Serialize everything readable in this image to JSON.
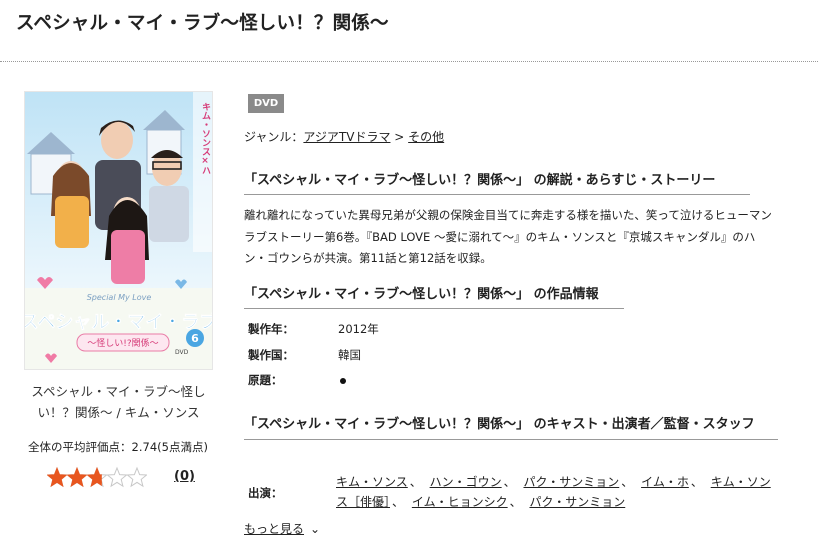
{
  "page_title": "スペシャル・マイ・ラブ〜怪しい！？関係〜",
  "cover": {
    "caption_lines": [
      "スペシャル・マイ・ラブ〜怪し",
      "い！？関係〜 / キム・ソンス"
    ],
    "side_text": "キム・ソンス×ハ",
    "logo_line1": "スペシャル・マイ・ラブ",
    "logo_line2": "〜怪しい!?関係〜",
    "logo_sub": "Special My Love",
    "volume": "6",
    "media": "DVD"
  },
  "rating": {
    "text": "全体の平均評価点：2.74(5点満点)",
    "value": 2.74,
    "max": 5,
    "review_count": "(0)",
    "star_color": "#e8561f"
  },
  "badge": "DVD",
  "genre": {
    "label": "ジャンル：",
    "items": [
      "アジアTVドラマ",
      "その他"
    ],
    "separator": " > "
  },
  "sections": {
    "story_heading": "「スペシャル・マイ・ラブ〜怪しい！？関係〜」 の解説・あらすじ・ストーリー",
    "story_text": "離れ離れになっていた異母兄弟が父親の保険金目当てに奔走する様を描いた、笑って泣けるヒューマンラブストーリー第6巻。『BAD LOVE 〜愛に溺れて〜』のキム・ソンスと『京城スキャンダル』のハン・ゴウンらが共演。第11話と第12話を収録。",
    "info_heading": "「スペシャル・マイ・ラブ〜怪しい！？関係〜」 の作品情報",
    "info_rows": [
      {
        "label": "製作年：",
        "value": "2012年"
      },
      {
        "label": "製作国：",
        "value": "韓国"
      },
      {
        "label": "原題：",
        "value": ""
      }
    ],
    "cast_heading": "「スペシャル・マイ・ラブ〜怪しい！？関係〜」 のキャスト・出演者／監督・スタッフ",
    "cast_label": "出演：",
    "cast": [
      "キム・ソンス",
      "ハン・ゴウン",
      "パク・サンミョン",
      "イム・ホ",
      "キム・ソンス［俳優］",
      "イム・ヒョンシク",
      "パク・サンミョン"
    ],
    "cast_separator": "、",
    "more_link": "もっと見る"
  }
}
